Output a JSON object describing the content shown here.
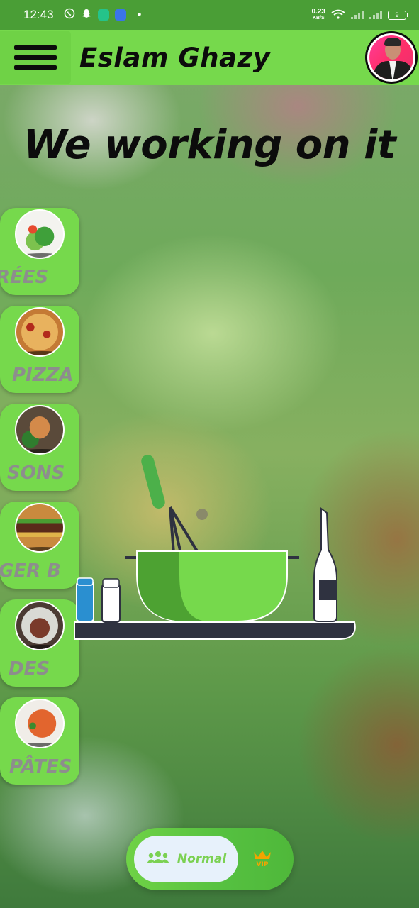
{
  "status_bar": {
    "time": "12:43",
    "net_speed_value": "0.23",
    "net_speed_unit": "KB/S",
    "battery": "9",
    "notification_icons": [
      "whatsapp-icon",
      "snapchat-icon",
      "clipboard-icon",
      "app-icon",
      "dot-icon"
    ]
  },
  "app_bar": {
    "title": "Eslam Ghazy",
    "menu_icon": "hamburger-icon",
    "avatar": "profile-avatar"
  },
  "main": {
    "headline": "We working on it"
  },
  "categories": [
    {
      "label": "RÉES",
      "image": "salad-image"
    },
    {
      "label": "PIZZA",
      "image": "pizza-image"
    },
    {
      "label": "SONS",
      "image": "fish-image"
    },
    {
      "label": "GER  B",
      "image": "burger-image"
    },
    {
      "label": "DES",
      "image": "steak-image"
    },
    {
      "label": "PÂTES",
      "image": "pasta-image"
    }
  ],
  "mode_toggle": {
    "normal_label": "Normal",
    "normal_icon": "group-icon",
    "vip_label": "VIP",
    "vip_icon": "crown-icon",
    "selected": "Normal"
  },
  "colors": {
    "status_bar": "#4a9e36",
    "app_bar": "#76d94c",
    "accent_green": "#76d94c",
    "category_label": "#8d8d8d",
    "vip": "#f2a400"
  }
}
